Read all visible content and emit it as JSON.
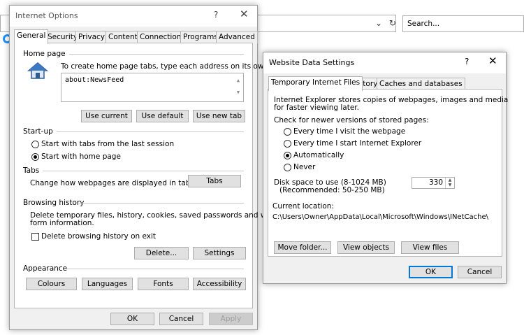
{
  "browser": {
    "search_placeholder": "Search...",
    "refresh_icon": "refresh-icon",
    "dropdown_icon": "chevron-down-icon"
  },
  "internet_options": {
    "title": "Internet Options",
    "help": "?",
    "close": "✕",
    "tabs": [
      "General",
      "Security",
      "Privacy",
      "Content",
      "Connections",
      "Programs",
      "Advanced"
    ],
    "home_page": {
      "heading": "Home page",
      "instruction": "To create home page tabs, type each address on its own line.",
      "value": "about:NewsFeed",
      "buttons": [
        "Use current",
        "Use default",
        "Use new tab"
      ]
    },
    "startup": {
      "heading": "Start-up",
      "options": [
        "Start with tabs from the last session",
        "Start with home page"
      ],
      "selected": 1
    },
    "tabs_section": {
      "heading": "Tabs",
      "description": "Change how webpages are displayed in tabs.",
      "button": "Tabs"
    },
    "browsing_history": {
      "heading": "Browsing history",
      "description_line1": "Delete temporary files, history, cookies, saved passwords and web",
      "description_line2": "form information.",
      "checkbox": "Delete browsing history on exit",
      "checked": false,
      "buttons": [
        "Delete...",
        "Settings"
      ]
    },
    "appearance": {
      "heading": "Appearance",
      "buttons": [
        "Colours",
        "Languages",
        "Fonts",
        "Accessibility"
      ]
    },
    "footer": {
      "ok": "OK",
      "cancel": "Cancel",
      "apply": "Apply"
    }
  },
  "website_data": {
    "title": "Website Data Settings",
    "help": "?",
    "close": "✕",
    "tabs": [
      "Temporary Internet Files",
      "History",
      "Caches and databases"
    ],
    "intro_line1": "Internet Explorer stores copies of webpages, images and media",
    "intro_line2": "for faster viewing later.",
    "check_heading": "Check for newer versions of stored pages:",
    "check_options": [
      "Every time I visit the webpage",
      "Every time I start Internet Explorer",
      "Automatically",
      "Never"
    ],
    "check_selected": 2,
    "disk_label1": "Disk space to use (8-1024 MB)",
    "disk_label2": "(Recommended: 50-250 MB)",
    "disk_value": "330",
    "location_heading": "Current location:",
    "location_path": "C:\\Users\\Owner\\AppData\\Local\\Microsoft\\Windows\\INetCache\\",
    "buttons": [
      "Move folder...",
      "View objects",
      "View files"
    ],
    "footer": {
      "ok": "OK",
      "cancel": "Cancel"
    }
  }
}
